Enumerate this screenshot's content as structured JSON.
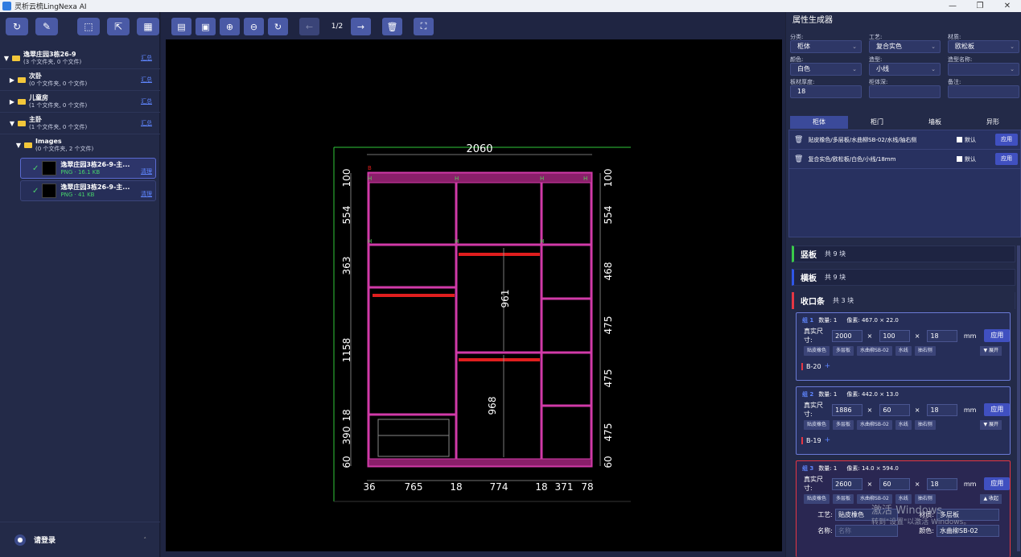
{
  "window": {
    "title": "灵析云梳LingNexa AI"
  },
  "left": {
    "tree": [
      {
        "name": "逸翠庄园3栋26-9",
        "sub": "(3 个文件夹, 0 个文件)",
        "summary": "汇总",
        "expanded": true
      },
      {
        "name": "次卧",
        "sub": "(0 个文件夹, 0 个文件)",
        "summary": "汇总",
        "expanded": false
      },
      {
        "name": "儿童房",
        "sub": "(1 个文件夹, 0 个文件)",
        "summary": "汇总",
        "expanded": false
      },
      {
        "name": "主卧",
        "sub": "(1 个文件夹, 0 个文件)",
        "summary": "汇总",
        "expanded": true
      },
      {
        "name": "Images",
        "sub": "(0 个文件夹, 2 个文件)",
        "expanded": true
      }
    ],
    "files": [
      {
        "name": "逸翠庄园3栋26-9-主...",
        "meta": "PNG · 16.1 KB",
        "clear": "清理"
      },
      {
        "name": "逸翠庄园3栋26-9-主...",
        "meta": "PNG · 41 KB",
        "clear": "清理"
      }
    ],
    "login": "请登录"
  },
  "center": {
    "page": "1/2"
  },
  "drawing": {
    "top_dim": "2060",
    "left_dims": [
      "100",
      "554",
      "363",
      "1158",
      "18",
      "390",
      "60"
    ],
    "right_dims": [
      "100",
      "554",
      "468",
      "475",
      "475",
      "475",
      "60"
    ],
    "bottom_dims": [
      "36",
      "765",
      "18",
      "774",
      "18",
      "371",
      "78"
    ],
    "inner_dims": [
      "961",
      "968"
    ],
    "marks": [
      "B",
      "H",
      "H",
      "H",
      "H",
      "H",
      "H",
      "H"
    ]
  },
  "right": {
    "title": "属性生成器",
    "fields": [
      {
        "label": "分类:",
        "value": "柜体",
        "dropdown": true
      },
      {
        "label": "工艺:",
        "value": "复合实色",
        "dropdown": true
      },
      {
        "label": "材质:",
        "value": "欧松板",
        "dropdown": true
      },
      {
        "label": "颜色:",
        "value": "白色",
        "dropdown": true
      },
      {
        "label": "造型:",
        "value": "小线",
        "dropdown": true
      },
      {
        "label": "造型名称:",
        "value": "",
        "dropdown": true
      },
      {
        "label": "板材厚度:",
        "value": "18"
      },
      {
        "label": "柜体深:",
        "value": ""
      },
      {
        "label": "备注:",
        "value": ""
      }
    ],
    "tabs": [
      "柜体",
      "柜门",
      "墙板",
      "异形"
    ],
    "rules": [
      {
        "text": "贴皮橡色/多层板/水曲柳SB-02/水线/抽右侧",
        "default_label": "默认",
        "apply": "应用"
      },
      {
        "text": "复合实色/欧松板/白色/小线/18mm",
        "default_label": "默认",
        "apply": "应用"
      }
    ],
    "sections": [
      {
        "title": "竖板",
        "count": "共 9 块"
      },
      {
        "title": "横板",
        "count": "共 9 块"
      },
      {
        "title": "收口条",
        "count": "共 3 块"
      }
    ],
    "groups": [
      {
        "title": "组 1",
        "qty": "数量: 1",
        "pixels": "像素: 467.0 × 22.0",
        "size_label": "真实尺寸:",
        "w": "2000",
        "h": "100",
        "d": "18",
        "unit": "mm",
        "apply": "应用",
        "tags": [
          "贴皮橡色",
          "多层板",
          "水曲柳SB-02",
          "水线",
          "抽右侧"
        ],
        "toggle": "▼ 展开",
        "ref": "B-20"
      },
      {
        "title": "组 2",
        "qty": "数量: 1",
        "pixels": "像素: 442.0 × 13.0",
        "size_label": "真实尺寸:",
        "w": "1886",
        "h": "60",
        "d": "18",
        "unit": "mm",
        "apply": "应用",
        "tags": [
          "贴皮橡色",
          "多层板",
          "水曲柳SB-02",
          "水线",
          "抽右侧"
        ],
        "toggle": "▼ 展开",
        "ref": "B-19"
      },
      {
        "title": "组 3",
        "qty": "数量: 1",
        "pixels": "像素: 14.0 × 594.0",
        "size_label": "真实尺寸:",
        "w": "2600",
        "h": "60",
        "d": "18",
        "unit": "mm",
        "apply": "应用",
        "tags": [
          "贴皮橡色",
          "多层板",
          "水曲柳SB-02",
          "水线",
          "抽右侧"
        ],
        "toggle": "▲ 收起",
        "detail": [
          {
            "k": "工艺:",
            "v": "贴皮橡色"
          },
          {
            "k": "材质:",
            "v": "多层板"
          },
          {
            "k": "名称:",
            "v": "",
            "ph": "名称"
          },
          {
            "k": "颜色:",
            "v": "水曲柳SB-02"
          }
        ]
      }
    ]
  },
  "watermark": {
    "line1": "激活 Windows",
    "line2": "转到\"设置\"以激活 Windows。"
  }
}
